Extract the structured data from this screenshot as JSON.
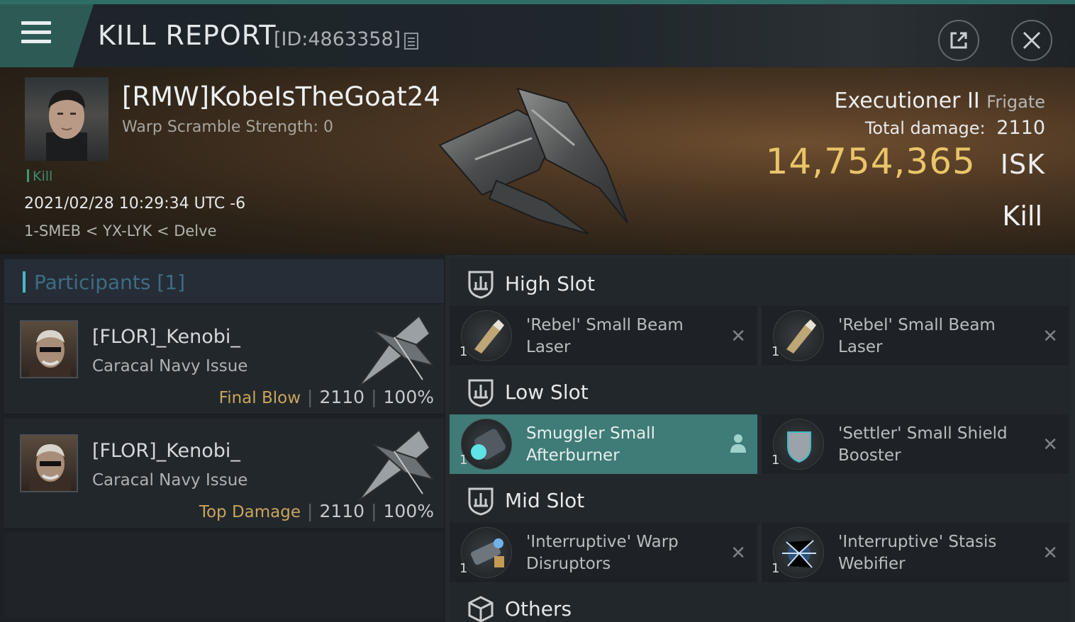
{
  "window": {
    "title": "KILL REPORT",
    "report_id": "[ID:4863358]"
  },
  "victim": {
    "name": "[RMW]KobeIsTheGoat24",
    "warp_scramble": "Warp Scramble Strength: 0",
    "tag": "Kill",
    "datetime": "2021/02/28 10:29:34 UTC -6",
    "location": "1-SMEB < YX-LYK < Delve",
    "ship_name": "Executioner II",
    "ship_class": "Frigate",
    "damage_label": "Total damage:",
    "damage_value": "2110",
    "isk_value": "14,754,365",
    "isk_unit": "ISK",
    "result": "Kill"
  },
  "participants": {
    "header": "Participants [1]",
    "rows": [
      {
        "name": "[FLOR]_Kenobi_",
        "ship": "Caracal Navy Issue",
        "role": "Final Blow",
        "damage": "2110",
        "percent": "100%"
      },
      {
        "name": "[FLOR]_Kenobi_",
        "ship": "Caracal Navy Issue",
        "role": "Top Damage",
        "damage": "2110",
        "percent": "100%"
      }
    ]
  },
  "slots": {
    "high": {
      "label": "High Slot",
      "items": [
        {
          "name": "'Rebel' Small Beam Laser",
          "qty": "1"
        },
        {
          "name": "'Rebel' Small Beam Laser",
          "qty": "1"
        }
      ]
    },
    "low": {
      "label": "Low Slot",
      "items": [
        {
          "name": "Smuggler Small Afterburner",
          "qty": "1"
        },
        {
          "name": "'Settler' Small Shield Booster",
          "qty": "1"
        }
      ]
    },
    "mid": {
      "label": "Mid Slot",
      "items": [
        {
          "name": "'Interruptive' Warp Disruptors",
          "qty": "1"
        },
        {
          "name": "'Interruptive' Stasis Webifier",
          "qty": "1"
        }
      ]
    },
    "others": {
      "label": "Others"
    }
  },
  "colors": {
    "accent": "#2f6d66",
    "isk": "#e9c569",
    "role": "#c9a55a",
    "highlight": "#3f7b77"
  },
  "icons": [
    "menu-icon",
    "copy-icon",
    "share-icon",
    "close-icon",
    "shield-slot-icon",
    "box-icon",
    "person-icon"
  ]
}
